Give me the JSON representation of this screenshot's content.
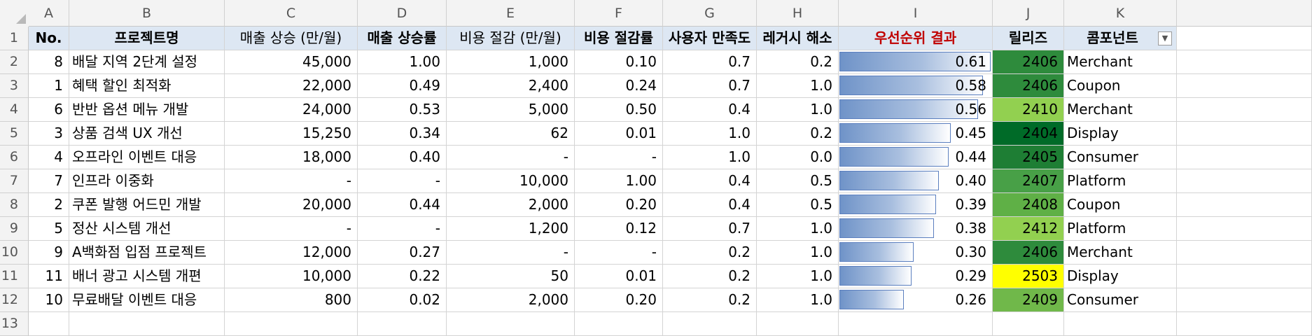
{
  "column_letters": [
    "A",
    "B",
    "C",
    "D",
    "E",
    "F",
    "G",
    "H",
    "I",
    "J",
    "K"
  ],
  "row_numbers": [
    "1",
    "2",
    "3",
    "4",
    "5",
    "6",
    "7",
    "8",
    "9",
    "10",
    "11",
    "12",
    "13"
  ],
  "headers": [
    "No.",
    "프로젝트명",
    "매출 상승 (만/월)",
    "매출 상승률",
    "비용 절감 (만/월)",
    "비용 절감률",
    "사용자 만족도",
    "레거시 해소",
    "우선순위 결과",
    "릴리즈",
    "콤포넌트"
  ],
  "filter_icon": "chevron-down-icon",
  "colors": {
    "header_fill": "#dde7f3",
    "priority_header_text": "#c00000",
    "databar": "#6f93c8"
  },
  "priority_max": 0.61,
  "rows": [
    {
      "no": "8",
      "name": "배달 지역 2단계 설정",
      "rev": "45,000",
      "rev_rate": "1.00",
      "cost": "1,000",
      "cost_rate": "0.10",
      "sat": "0.7",
      "legacy": "0.2",
      "priority": "0.61",
      "priority_value": 0.61,
      "release": "2406",
      "release_color": "#2e8b3c",
      "component": "Merchant"
    },
    {
      "no": "1",
      "name": "혜택 할인 최적화",
      "rev": "22,000",
      "rev_rate": "0.49",
      "cost": "2,400",
      "cost_rate": "0.24",
      "sat": "0.7",
      "legacy": "1.0",
      "priority": "0.58",
      "priority_value": 0.58,
      "release": "2406",
      "release_color": "#2e8b3c",
      "component": "Coupon"
    },
    {
      "no": "6",
      "name": "반반 옵션 메뉴 개발",
      "rev": "24,000",
      "rev_rate": "0.53",
      "cost": "5,000",
      "cost_rate": "0.50",
      "sat": "0.4",
      "legacy": "1.0",
      "priority": "0.56",
      "priority_value": 0.56,
      "release": "2410",
      "release_color": "#92d050",
      "component": "Merchant"
    },
    {
      "no": "3",
      "name": "상품 검색 UX 개선",
      "rev": "15,250",
      "rev_rate": "0.34",
      "cost": "62",
      "cost_rate": "0.01",
      "sat": "1.0",
      "legacy": "0.2",
      "priority": "0.45",
      "priority_value": 0.45,
      "release": "2404",
      "release_color": "#006b28",
      "component": "Display"
    },
    {
      "no": "4",
      "name": "오프라인 이벤트 대응",
      "rev": "18,000",
      "rev_rate": "0.40",
      "cost": "-",
      "cost_rate": "-",
      "sat": "1.0",
      "legacy": "0.0",
      "priority": "0.44",
      "priority_value": 0.44,
      "release": "2405",
      "release_color": "#1e7e34",
      "component": "Consumer"
    },
    {
      "no": "7",
      "name": "인프라 이중화",
      "rev": "-",
      "rev_rate": "-",
      "cost": "10,000",
      "cost_rate": "1.00",
      "sat": "0.4",
      "legacy": "0.5",
      "priority": "0.40",
      "priority_value": 0.4,
      "release": "2407",
      "release_color": "#48a047",
      "component": "Platform"
    },
    {
      "no": "2",
      "name": "쿠폰 발행 어드민 개발",
      "rev": "20,000",
      "rev_rate": "0.44",
      "cost": "2,000",
      "cost_rate": "0.20",
      "sat": "0.4",
      "legacy": "0.5",
      "priority": "0.39",
      "priority_value": 0.39,
      "release": "2408",
      "release_color": "#5fb046",
      "component": "Coupon"
    },
    {
      "no": "5",
      "name": "정산 시스템 개선",
      "rev": "-",
      "rev_rate": "-",
      "cost": "1,200",
      "cost_rate": "0.12",
      "sat": "0.7",
      "legacy": "1.0",
      "priority": "0.38",
      "priority_value": 0.38,
      "release": "2412",
      "release_color": "#92d050",
      "component": "Platform"
    },
    {
      "no": "9",
      "name": "A백화점 입점 프로젝트",
      "rev": "12,000",
      "rev_rate": "0.27",
      "cost": "-",
      "cost_rate": "-",
      "sat": "0.2",
      "legacy": "1.0",
      "priority": "0.30",
      "priority_value": 0.3,
      "release": "2406",
      "release_color": "#2e8b3c",
      "component": "Merchant"
    },
    {
      "no": "11",
      "name": "배너 광고 시스템 개편",
      "rev": "10,000",
      "rev_rate": "0.22",
      "cost": "50",
      "cost_rate": "0.01",
      "sat": "0.2",
      "legacy": "1.0",
      "priority": "0.29",
      "priority_value": 0.29,
      "release": "2503",
      "release_color": "#ffff00",
      "component": "Display"
    },
    {
      "no": "10",
      "name": "무료배달 이벤트 대응",
      "rev": "800",
      "rev_rate": "0.02",
      "cost": "2,000",
      "cost_rate": "0.20",
      "sat": "0.2",
      "legacy": "1.0",
      "priority": "0.26",
      "priority_value": 0.26,
      "release": "2409",
      "release_color": "#70b84a",
      "component": "Consumer"
    }
  ]
}
